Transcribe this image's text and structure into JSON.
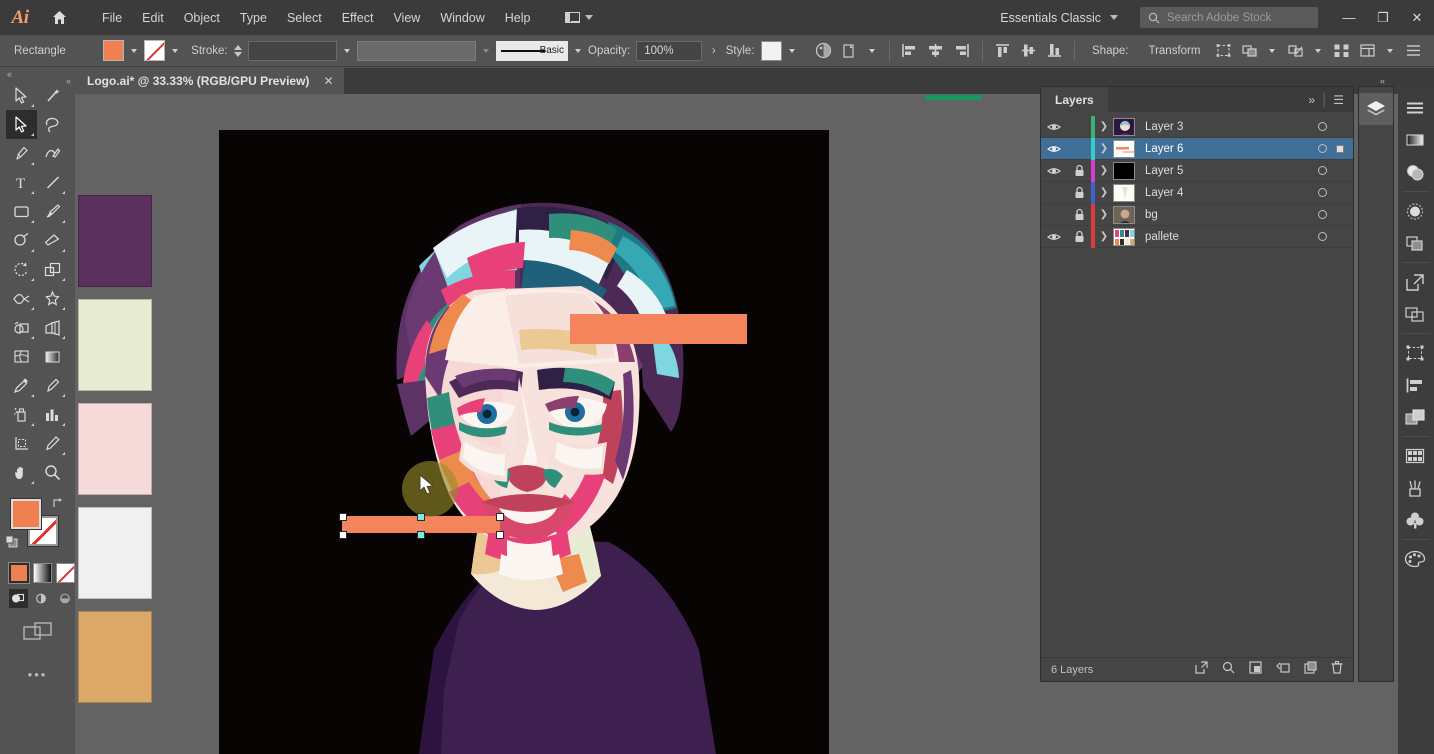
{
  "app": {
    "name": "Adobe Illustrator",
    "logo_text": "Ai",
    "accent_color": "#f59b6a"
  },
  "menubar": {
    "items": [
      {
        "label": "File"
      },
      {
        "label": "Edit"
      },
      {
        "label": "Object"
      },
      {
        "label": "Type"
      },
      {
        "label": "Select"
      },
      {
        "label": "Effect"
      },
      {
        "label": "View"
      },
      {
        "label": "Window"
      },
      {
        "label": "Help"
      }
    ],
    "workspace": "Essentials Classic",
    "search_placeholder": "Search Adobe Stock",
    "window_minimize": "—",
    "window_restore": "❐",
    "window_close": "✕"
  },
  "controlbar": {
    "object_label": "Rectangle",
    "fill_color": "#f08050",
    "stroke_swatch": "none",
    "stroke_label": "Stroke:",
    "stroke_weight": "",
    "stroke_profile": "Basic",
    "opacity_label": "Opacity:",
    "opacity_value": "100%",
    "opacity_arrow": "›",
    "style_label": "Style:",
    "shape_label": "Shape:",
    "transform_label": "Transform",
    "icons": [
      "recolor-artwork-icon",
      "align-left-icon",
      "align-center-horizontal-icon",
      "align-right-icon",
      "align-top-icon",
      "align-center-vertical-icon",
      "align-bottom-icon",
      "isolate-icon",
      "arrange-icon",
      "flip-icon",
      "more-options-icon",
      "document-setup-icon"
    ]
  },
  "document_tab": {
    "title": "Logo.ai* @ 33.33% (RGB/GPU Preview)",
    "close_label": "✕"
  },
  "toolbar": {
    "collapse_label": "«",
    "tools": [
      {
        "name": "selection-tool",
        "active": false
      },
      {
        "name": "magic-wand-tool",
        "active": false
      },
      {
        "name": "direct-selection-tool",
        "active": true
      },
      {
        "name": "lasso-tool",
        "active": false
      },
      {
        "name": "pen-tool",
        "active": false
      },
      {
        "name": "curvature-tool",
        "active": false
      },
      {
        "name": "type-tool",
        "active": false
      },
      {
        "name": "line-segment-tool",
        "active": false
      },
      {
        "name": "rectangle-tool",
        "active": false
      },
      {
        "name": "paintbrush-tool",
        "active": false
      },
      {
        "name": "shaper-tool",
        "active": false
      },
      {
        "name": "eraser-tool",
        "active": false
      },
      {
        "name": "rotate-tool",
        "active": false
      },
      {
        "name": "scale-tool",
        "active": false
      },
      {
        "name": "width-tool",
        "active": false
      },
      {
        "name": "free-transform-tool",
        "active": false
      },
      {
        "name": "shape-builder-tool",
        "active": false
      },
      {
        "name": "perspective-grid-tool",
        "active": false
      },
      {
        "name": "mesh-tool",
        "active": false
      },
      {
        "name": "gradient-tool",
        "active": false
      },
      {
        "name": "eyedropper-tool",
        "active": false
      },
      {
        "name": "blend-tool",
        "active": false
      },
      {
        "name": "symbol-sprayer-tool",
        "active": false
      },
      {
        "name": "column-graph-tool",
        "active": false
      },
      {
        "name": "artboard-tool",
        "active": false
      },
      {
        "name": "slice-tool",
        "active": false
      },
      {
        "name": "hand-tool",
        "active": false
      },
      {
        "name": "zoom-tool",
        "active": false
      }
    ],
    "fill_color": "#f08050",
    "stroke_color": "none",
    "draw_modes": [
      "draw-normal",
      "draw-behind",
      "draw-inside"
    ],
    "more_label": "•••"
  },
  "canvas": {
    "background": "#636363",
    "artboard_background": "#080404",
    "palette_swatches": [
      {
        "name": "swatch-purple",
        "color": "#5b2f5e"
      },
      {
        "name": "swatch-cream",
        "color": "#e8ecd3"
      },
      {
        "name": "swatch-pink",
        "color": "#f6dada"
      },
      {
        "name": "swatch-white",
        "color": "#f0f0f0"
      },
      {
        "name": "swatch-tan",
        "color": "#dba868"
      }
    ],
    "selected_shape": {
      "name": "orange-rectangle",
      "fill": "#f4845c",
      "anchor_color": "#ffffff",
      "highlight_color": "#7fe9e0"
    },
    "artwork_title": "WPAP geometric portrait",
    "orange_bar_color": "#f4845c",
    "shirt_color": "#3d2050"
  },
  "layers_panel": {
    "tab_label": "Layers",
    "expand_icon": "»",
    "menu_icon": "☰",
    "layers": [
      {
        "name": "Layer 3",
        "visible": true,
        "locked": false,
        "color": "#3cb371",
        "selected": false,
        "thumb": "portrait"
      },
      {
        "name": "Layer 6",
        "visible": true,
        "locked": false,
        "color": "#3fc8c8",
        "selected": true,
        "thumb": "bars"
      },
      {
        "name": "Layer 5",
        "visible": true,
        "locked": true,
        "color": "#d23fd2",
        "selected": false,
        "thumb": "black"
      },
      {
        "name": "Layer 4",
        "visible": false,
        "locked": true,
        "color": "#4060d0",
        "selected": false,
        "thumb": "cream"
      },
      {
        "name": "bg",
        "visible": false,
        "locked": true,
        "color": "#e03a3a",
        "selected": false,
        "thumb": "photo"
      },
      {
        "name": "pallete",
        "visible": true,
        "locked": true,
        "color": "#e03a3a",
        "selected": false,
        "thumb": "palette"
      }
    ],
    "footer_count": "6 Layers",
    "footer_icons": [
      "locate-object-icon",
      "make-clipping-mask-icon",
      "create-new-sublayer-icon",
      "create-new-layer-icon",
      "delete-selection-icon"
    ]
  },
  "right_dock": {
    "primary": [
      {
        "name": "layers-panel-icon",
        "active": true
      }
    ],
    "secondary": [
      {
        "name": "properties-icon"
      },
      {
        "name": "gradient-icon"
      },
      {
        "name": "appearance-icon"
      },
      {
        "name": "transparency-icon"
      },
      {
        "name": "pathfinder-icon"
      },
      {
        "name": "export-icon"
      },
      {
        "name": "artboards-icon"
      },
      {
        "name": "transform-panel-icon"
      },
      {
        "name": "align-panel-icon"
      },
      {
        "name": "libraries-icon"
      },
      {
        "name": "swatches-icon"
      },
      {
        "name": "brushes-icon"
      },
      {
        "name": "symbols-icon"
      },
      {
        "name": "color-panel-icon"
      }
    ]
  }
}
